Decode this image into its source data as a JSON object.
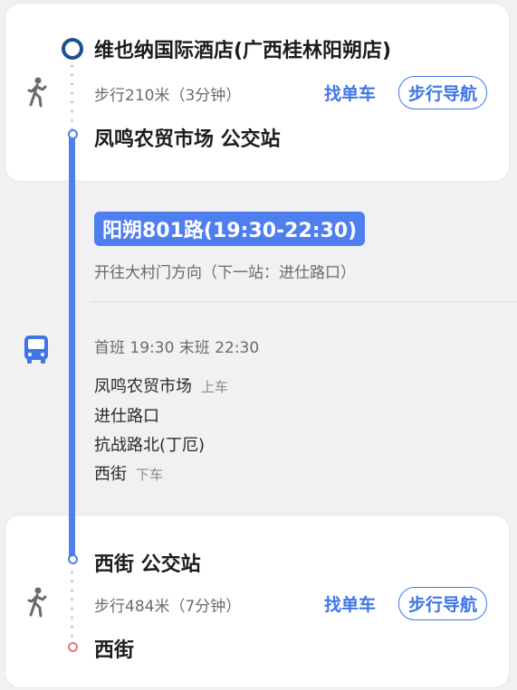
{
  "walk_start": {
    "origin": "维也纳国际酒店(广西桂林阳朔店)",
    "detail": "步行210米（3分钟）",
    "find_bike": "找单车",
    "walk_nav": "步行导航",
    "destination": "凤鸣农贸市场 公交站"
  },
  "bus": {
    "route_badge": "阳朔801路(19:30-22:30)",
    "direction": "开往大村门方向（下一站：进仕路口）",
    "schedule": "首班 19:30  末班 22:30",
    "stops": [
      {
        "name": "凤鸣农贸市场",
        "tag": "上车"
      },
      {
        "name": "进仕路口",
        "tag": ""
      },
      {
        "name": "抗战路北(丁厄)",
        "tag": ""
      },
      {
        "name": "西街",
        "tag": "下车"
      }
    ]
  },
  "walk_end": {
    "origin": "西街 公交站",
    "detail": "步行484米（7分钟）",
    "find_bike": "找单车",
    "walk_nav": "步行导航",
    "destination": "西街"
  },
  "colors": {
    "accent": "#3f76e6",
    "route_line": "#4f7ef0",
    "end_marker": "#e07a7a"
  },
  "icons": [
    "walk-icon",
    "bus-icon",
    "walk-icon"
  ]
}
